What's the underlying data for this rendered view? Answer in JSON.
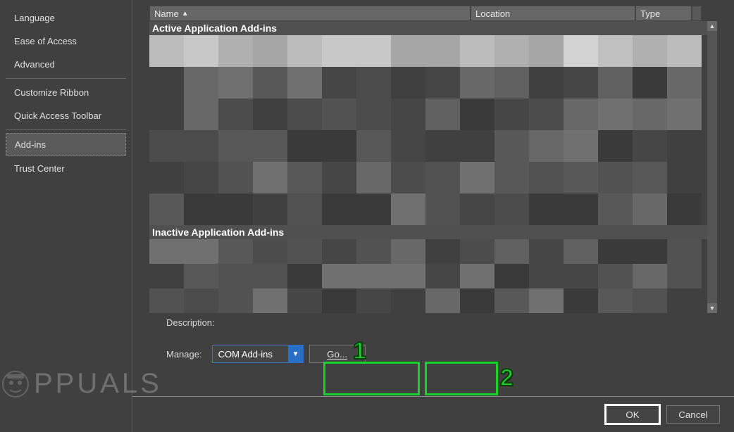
{
  "sidebar": {
    "items": [
      {
        "label": "Language",
        "selected": false
      },
      {
        "label": "Ease of Access",
        "selected": false
      },
      {
        "label": "Advanced",
        "selected": false
      },
      {
        "label": "Customize Ribbon",
        "selected": false
      },
      {
        "label": "Quick Access Toolbar",
        "selected": false
      },
      {
        "label": "Add-ins",
        "selected": true
      },
      {
        "label": "Trust Center",
        "selected": false
      }
    ]
  },
  "columns": {
    "name": "Name",
    "location": "Location",
    "type": "Type",
    "sort_indicator": "▲"
  },
  "sections": {
    "active": "Active Application Add-ins",
    "inactive": "Inactive Application Add-ins"
  },
  "description": {
    "label": "Description:"
  },
  "manage": {
    "label": "Manage:",
    "selected": "COM Add-ins",
    "go_label": "Go..."
  },
  "buttons": {
    "ok": "OK",
    "cancel": "Cancel"
  },
  "annotations": {
    "one": "1",
    "two": "2"
  },
  "watermark": {
    "text": "PPUALS"
  }
}
